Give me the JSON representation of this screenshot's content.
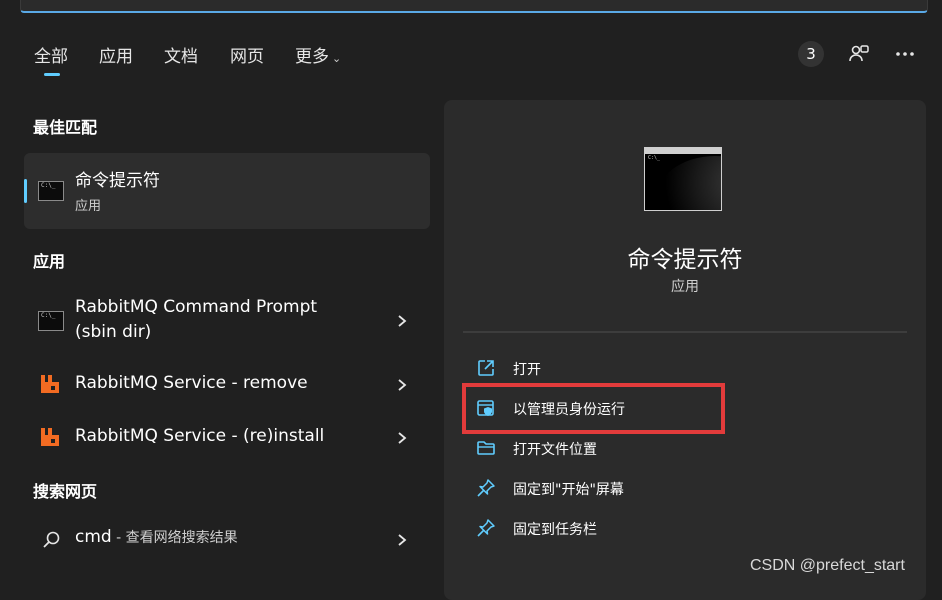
{
  "tabs": [
    "全部",
    "应用",
    "文档",
    "网页",
    "更多"
  ],
  "badge_count": "3",
  "sections": {
    "best_match": "最佳匹配",
    "apps": "应用",
    "web": "搜索网页"
  },
  "best_match": {
    "title": "命令提示符",
    "subtitle": "应用",
    "icon_text": "C:\\_"
  },
  "apps": [
    {
      "label_line1": "RabbitMQ Command Prompt",
      "label_line2": "(sbin dir)",
      "icon": "cmd-icon"
    },
    {
      "label_line1": "RabbitMQ Service - remove",
      "icon": "rabbitmq-icon"
    },
    {
      "label_line1": "RabbitMQ Service - (re)install",
      "icon": "rabbitmq-icon"
    }
  ],
  "web_search": {
    "query": "cmd",
    "suffix": " - 查看网络搜索结果"
  },
  "detail": {
    "title": "命令提示符",
    "subtitle": "应用",
    "actions": [
      {
        "label": "打开",
        "icon": "open-external-icon"
      },
      {
        "label": "以管理员身份运行",
        "icon": "run-as-admin-icon"
      },
      {
        "label": "打开文件位置",
        "icon": "folder-icon"
      },
      {
        "label": "固定到\"开始\"屏幕",
        "icon": "pin-icon"
      },
      {
        "label": "固定到任务栏",
        "icon": "pin-icon"
      }
    ]
  },
  "colors": {
    "accent": "#60cdff",
    "highlight": "#e23b3b",
    "rabbitmq": "#f26b22"
  },
  "watermark": "CSDN @prefect_start"
}
